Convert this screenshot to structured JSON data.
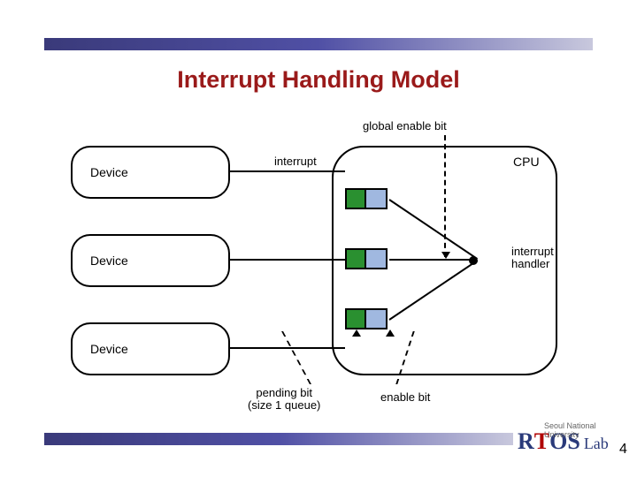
{
  "title": "Interrupt Handling Model",
  "global_enable_label": "global enable bit",
  "cpu_label": "CPU",
  "interrupt_handler_label_l1": "interrupt",
  "interrupt_handler_label_l2": "handler",
  "devices": {
    "d1": "Device",
    "d2": "Device",
    "d3": "Device"
  },
  "interrupt_label": "interrupt",
  "pending_label_l1": "pending bit",
  "pending_label_l2": "(size 1 queue)",
  "enable_label": "enable bit",
  "logo": {
    "university": "Seoul National University",
    "r": "R",
    "t": "T",
    "os": "OS",
    "lab": "Lab"
  },
  "page_number": "4"
}
